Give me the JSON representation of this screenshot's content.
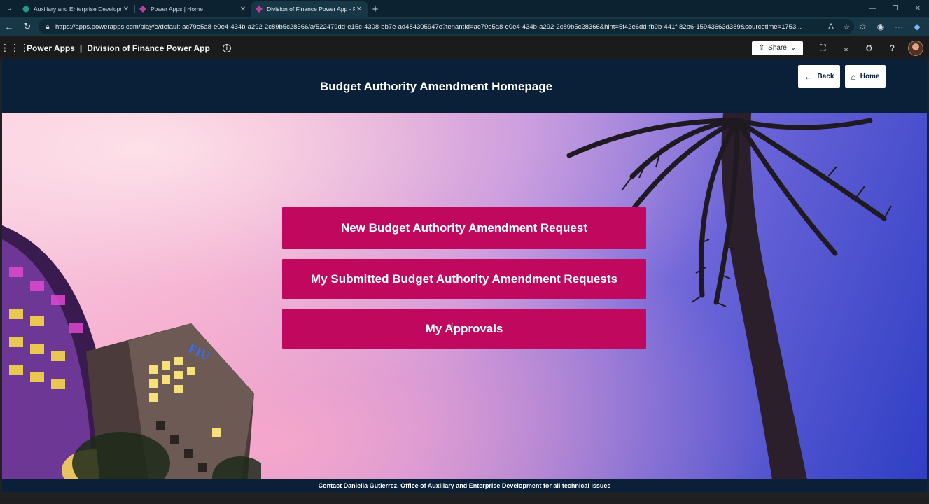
{
  "browser": {
    "tabs": [
      {
        "title": "Auxiliary and Enterprise Developme",
        "favicon_color": "#1f9d8b"
      },
      {
        "title": "Power Apps | Home",
        "favicon_color": "#c23a9a"
      },
      {
        "title": "Division of Finance Power App - P",
        "favicon_color": "#c23a9a",
        "active": true
      }
    ],
    "url": "https://apps.powerapps.com/play/e/default-ac79e5a8-e0e4-434b-a292-2c89b5c28366/a/522479dd-e15c-4308-bb7e-ad484305947c?tenantId=ac79e5a8-e0e4-434b-a292-2c89b5c28366&hint=5f42e6dd-fb9b-441f-82b6-15943663d389&sourcetime=1753..."
  },
  "powerapps": {
    "product": "Power Apps",
    "separator": "|",
    "app_name": "Division of Finance Power App",
    "share_label": "Share"
  },
  "app": {
    "title": "Budget Authority Amendment Homepage",
    "back_label": "Back",
    "home_label": "Home",
    "buttons": [
      "New Budget Authority Amendment Request",
      "My Submitted Budget Authority Amendment Requests",
      "My Approvals"
    ],
    "footer": "Contact Daniella Gutierrez, Office of Auxiliary and Enterprise Development for all technical issues",
    "building_sign": "FIU",
    "accent_color": "#c0085f",
    "header_color": "#0a1f38"
  }
}
